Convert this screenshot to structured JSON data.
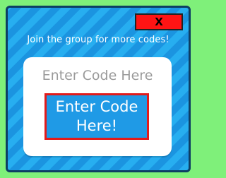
{
  "dialog": {
    "close_label": "X",
    "subtitle": "Join the group for more codes!",
    "input_placeholder": "Enter Code Here",
    "submit_label_line1": "Enter Code",
    "submit_label_line2": "Here!"
  },
  "colors": {
    "page_background": "#7ff07a",
    "panel_stripe_light": "#27aef0",
    "panel_stripe_dark": "#1b94e0",
    "panel_border": "#0d3e63",
    "close_button": "#ff1414",
    "submit_button": "#1f9ae6",
    "submit_border": "#e21b1b",
    "card_background": "#ffffff",
    "placeholder_text": "#9a9a9a"
  }
}
